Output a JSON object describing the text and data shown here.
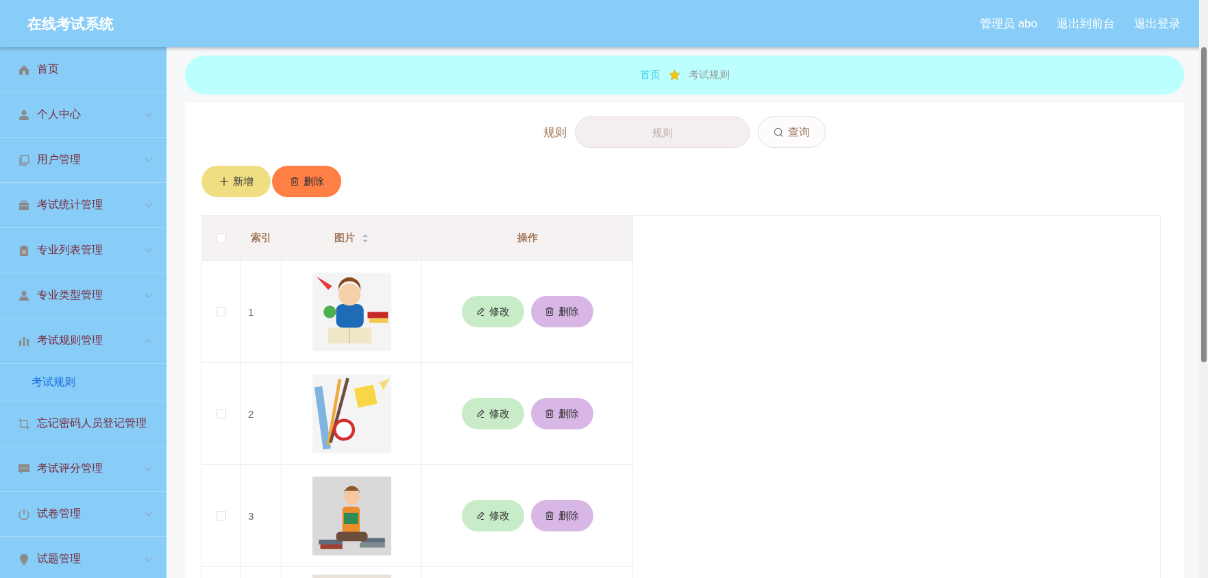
{
  "header": {
    "title": "在线考试系统",
    "links": [
      "管理员 abo",
      "退出到前台",
      "退出登录"
    ]
  },
  "sidebar": {
    "items": [
      {
        "kind": "link",
        "label": "首页"
      },
      {
        "kind": "submenu",
        "label": "个人中心",
        "expanded": false
      },
      {
        "kind": "submenu",
        "label": "用户管理",
        "expanded": false
      },
      {
        "kind": "submenu",
        "label": "考试统计管理",
        "expanded": false
      },
      {
        "kind": "submenu",
        "label": "专业列表管理",
        "expanded": false
      },
      {
        "kind": "submenu",
        "label": "专业类型管理",
        "expanded": false
      },
      {
        "kind": "submenu",
        "label": "考试规则管理",
        "expanded": true,
        "children": [
          {
            "label": "考试规则",
            "selected": true
          }
        ]
      },
      {
        "kind": "link",
        "label": "忘记密码人员登记管理"
      },
      {
        "kind": "submenu",
        "label": "考试评分管理",
        "expanded": false
      },
      {
        "kind": "submenu",
        "label": "试卷管理",
        "expanded": false
      },
      {
        "kind": "submenu",
        "label": "试题管理",
        "expanded": false
      }
    ]
  },
  "breadcrumb": [
    "首页",
    "考试规则"
  ],
  "search": {
    "label": "规则",
    "placeholder": "规则",
    "button": "查询"
  },
  "actions": [
    "新增",
    "删除"
  ],
  "table": {
    "select_all": {
      "checked": false
    },
    "columns": [
      "索引",
      "图片",
      "操作"
    ],
    "rows": [
      {
        "checked": false,
        "index": "1",
        "image": {
          "kind": "picture"
        },
        "buttons": [
          "修改",
          "删除"
        ]
      },
      {
        "checked": false,
        "index": "2",
        "image": {
          "kind": "picture"
        },
        "buttons": [
          "修改",
          "删除"
        ]
      },
      {
        "checked": false,
        "index": "3",
        "image": {
          "kind": "picture"
        },
        "buttons": [
          "修改",
          "删除"
        ]
      },
      {
        "image": {
          "kind": "picture"
        }
      }
    ]
  }
}
